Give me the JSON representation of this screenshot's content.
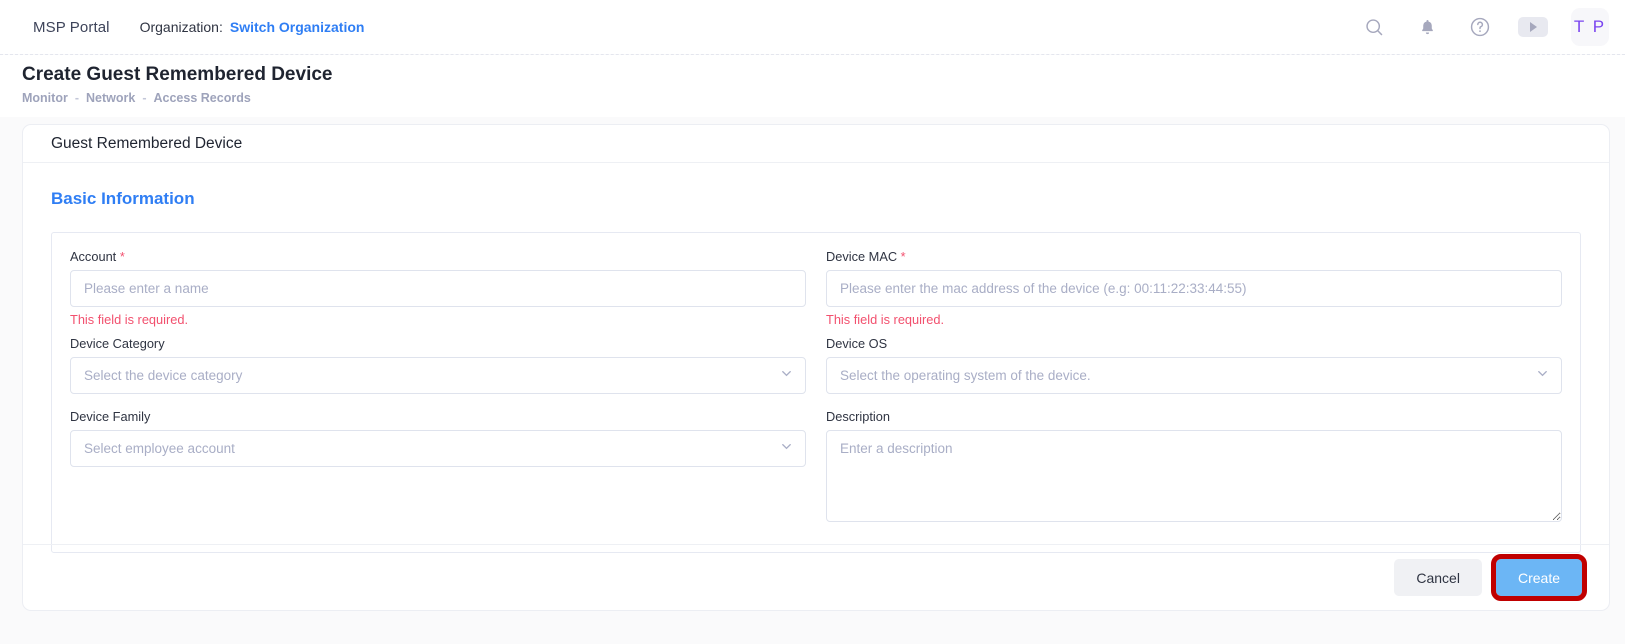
{
  "topbar": {
    "brand": "MSP Portal",
    "org_label": "Organization:",
    "org_link": "Switch Organization",
    "icons": {
      "search": "search-icon",
      "bell": "bell-icon",
      "help": "help-circle-icon",
      "play": "play-icon"
    },
    "avatar_initials": "T P"
  },
  "page": {
    "title": "Create Guest Remembered Device",
    "breadcrumb": [
      "Monitor",
      "Network",
      "Access Records"
    ],
    "breadcrumb_separator": "-"
  },
  "card": {
    "header_title": "Guest Remembered Device",
    "section_title": "Basic Information"
  },
  "fields": {
    "account": {
      "label": "Account",
      "required_mark": "*",
      "placeholder": "Please enter a name",
      "value": "",
      "error": "This field is required."
    },
    "device_mac": {
      "label": "Device MAC",
      "required_mark": "*",
      "placeholder": "Please enter the mac address of the device (e.g: 00:11:22:33:44:55)",
      "value": "",
      "error": "This field is required."
    },
    "device_category": {
      "label": "Device Category",
      "placeholder": "Select the device category",
      "value": ""
    },
    "device_os": {
      "label": "Device OS",
      "placeholder": "Select the operating system of the device.",
      "value": ""
    },
    "device_family": {
      "label": "Device Family",
      "placeholder": "Select employee account",
      "value": ""
    },
    "description": {
      "label": "Description",
      "placeholder": "Enter a description",
      "value": ""
    }
  },
  "footer": {
    "cancel_label": "Cancel",
    "create_label": "Create"
  },
  "colors": {
    "accent_blue": "#2f7ef4",
    "primary_button": "#6cb6f5",
    "error_red": "#f2506e",
    "highlight_red": "#c00000",
    "avatar_purple": "#7a45f0"
  }
}
